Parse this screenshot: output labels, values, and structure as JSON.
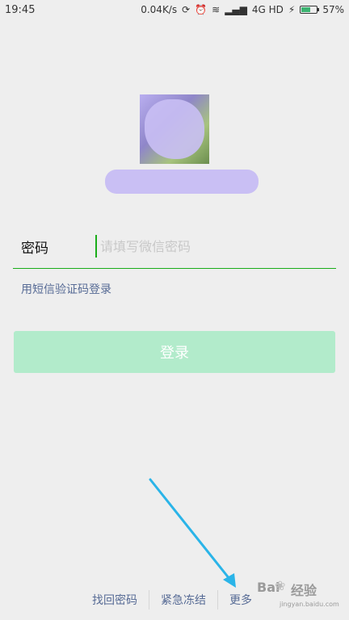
{
  "status_bar": {
    "time": "19:45",
    "net_speed": "0.04K/s",
    "network": "4G HD",
    "battery": "57%",
    "battery_level": 0.57
  },
  "login": {
    "password_label": "密码",
    "password_placeholder": "请填写微信密码",
    "sms_link": "用短信验证码登录",
    "login_button": "登录"
  },
  "bottom_links": {
    "find_password": "找回密码",
    "emergency_freeze": "紧急冻结",
    "more": "更多"
  },
  "watermark": {
    "title": "Bai",
    "title2": "经验",
    "subtitle": "jingyan.baidu.com"
  },
  "colors": {
    "accent": "#1aad19",
    "link": "#576b95",
    "button_disabled": "#b2ebcb",
    "annotation_arrow": "#2ab4e8"
  }
}
